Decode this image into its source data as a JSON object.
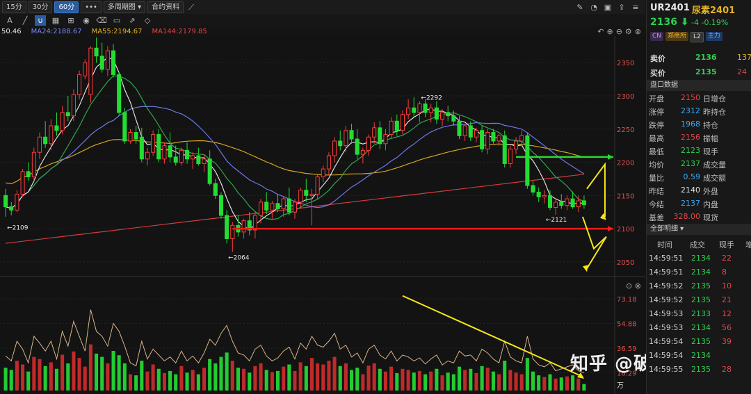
{
  "toolbar": {
    "periods": [
      "15分",
      "30分",
      "60分"
    ],
    "active_period": "60分",
    "multi_period": "多周期图",
    "contract_info": "合约资料",
    "letter_a": "A"
  },
  "ma_legend": [
    {
      "label": "50.46",
      "color": "#e6e6e6"
    },
    {
      "label": "MA24:2188.67",
      "color": "#7b86ff"
    },
    {
      "label": "MA55:2194.67",
      "color": "#e6b422"
    },
    {
      "label": "MA144:2179.85",
      "color": "#e64545"
    }
  ],
  "side": {
    "symbol": "UR2401",
    "name": "尿素2401",
    "price": "2136",
    "change": "-4",
    "change_pct": "-0.19%",
    "badges": [
      "CN",
      "郑商所",
      "L2",
      "主力"
    ],
    "ask_label": "卖价",
    "ask_price": "2136",
    "ask_vol": "137",
    "bid_label": "买价",
    "bid_price": "2135",
    "bid_vol": "24",
    "panel_title": "盘口数据",
    "stats": [
      {
        "k": "开盘",
        "v": "2150",
        "c": "#e64545",
        "k2": "日增仓"
      },
      {
        "k": "涨停",
        "v": "2312",
        "c": "#3fa9f5",
        "k2": "昨持仓"
      },
      {
        "k": "跌停",
        "v": "1968",
        "c": "#3fa9f5",
        "k2": "持仓"
      },
      {
        "k": "最高",
        "v": "2156",
        "c": "#e64545",
        "k2": "振幅"
      },
      {
        "k": "最低",
        "v": "2123",
        "c": "#2fd14f",
        "k2": "现手"
      },
      {
        "k": "均价",
        "v": "2137",
        "c": "#2fd14f",
        "k2": "成交量"
      },
      {
        "k": "量比",
        "v": "0.59",
        "c": "#3fa9f5",
        "k2": "成交额"
      },
      {
        "k": "昨结",
        "v": "2140",
        "c": "#e0e0e0",
        "k2": "外盘"
      },
      {
        "k": "今结",
        "v": "2137",
        "c": "#3fa9f5",
        "k2": "内盘"
      },
      {
        "k": "基差",
        "v": "328.00",
        "c": "#e64545",
        "k2": "现货"
      }
    ],
    "trades_title": "全部明细",
    "trade_cols": [
      "时间",
      "成交",
      "现手",
      "增"
    ],
    "trades": [
      {
        "t": "14:59:51",
        "p": "2134",
        "q": "22"
      },
      {
        "t": "14:59:51",
        "p": "2134",
        "q": "8"
      },
      {
        "t": "14:59:52",
        "p": "2135",
        "q": "10"
      },
      {
        "t": "14:59:52",
        "p": "2135",
        "q": "21"
      },
      {
        "t": "14:59:53",
        "p": "2133",
        "q": "12"
      },
      {
        "t": "14:59:53",
        "p": "2134",
        "q": "56"
      },
      {
        "t": "14:59:54",
        "p": "2135",
        "q": "39"
      },
      {
        "t": "14:59:54",
        "p": "2134",
        "q": ""
      },
      {
        "t": "14:59:55",
        "p": "2135",
        "q": "28"
      }
    ]
  },
  "watermark": "知乎 @破晓投研",
  "chart_data": {
    "type": "candlestick",
    "price_axis": {
      "ticks": [
        2350,
        2300,
        2250,
        2200,
        2150,
        2100,
        2050
      ],
      "range": [
        2030,
        2390
      ]
    },
    "volume_axis": {
      "ticks": [
        "73.18",
        "54.88",
        "36.59",
        "18.29"
      ],
      "unit": "万"
    },
    "annotations": [
      {
        "text": "2109",
        "value": 2109
      },
      {
        "text": "2064",
        "value": 2064
      },
      {
        "text": "2292",
        "value": 2292
      },
      {
        "text": "2121",
        "value": 2121
      }
    ],
    "levels": [
      {
        "name": "resistance",
        "value": 2208,
        "color": "#2bd92b"
      },
      {
        "name": "support",
        "value": 2100,
        "color": "#ff1a1a"
      }
    ],
    "candles": [
      [
        2150,
        2160,
        2118,
        2133
      ],
      [
        2133,
        2140,
        2120,
        2128
      ],
      [
        2128,
        2158,
        2125,
        2152
      ],
      [
        2152,
        2190,
        2148,
        2186
      ],
      [
        2186,
        2200,
        2172,
        2178
      ],
      [
        2178,
        2222,
        2172,
        2215
      ],
      [
        2215,
        2245,
        2205,
        2238
      ],
      [
        2238,
        2262,
        2222,
        2228
      ],
      [
        2228,
        2265,
        2218,
        2255
      ],
      [
        2255,
        2275,
        2240,
        2248
      ],
      [
        2248,
        2285,
        2242,
        2275
      ],
      [
        2275,
        2300,
        2262,
        2270
      ],
      [
        2270,
        2310,
        2262,
        2302
      ],
      [
        2302,
        2338,
        2295,
        2332
      ],
      [
        2330,
        2355,
        2325,
        2350
      ],
      [
        2302,
        2375,
        2290,
        2372
      ],
      [
        2372,
        2388,
        2350,
        2360
      ],
      [
        2360,
        2380,
        2335,
        2340
      ],
      [
        2340,
        2375,
        2330,
        2368
      ],
      [
        2368,
        2378,
        2328,
        2332
      ],
      [
        2332,
        2336,
        2270,
        2275
      ],
      [
        2275,
        2282,
        2228,
        2232
      ],
      [
        2232,
        2250,
        2228,
        2245
      ],
      [
        2245,
        2255,
        2228,
        2235
      ],
      [
        2238,
        2252,
        2200,
        2205
      ],
      [
        2205,
        2222,
        2195,
        2215
      ],
      [
        2215,
        2248,
        2210,
        2242
      ],
      [
        2242,
        2250,
        2200,
        2205
      ],
      [
        2205,
        2230,
        2198,
        2225
      ],
      [
        2225,
        2245,
        2200,
        2208
      ],
      [
        2208,
        2225,
        2195,
        2200
      ],
      [
        2200,
        2222,
        2195,
        2218
      ],
      [
        2218,
        2230,
        2198,
        2205
      ],
      [
        2205,
        2215,
        2190,
        2210
      ],
      [
        2210,
        2222,
        2195,
        2198
      ],
      [
        2198,
        2212,
        2185,
        2205
      ],
      [
        2205,
        2218,
        2165,
        2168
      ],
      [
        2168,
        2175,
        2145,
        2150
      ],
      [
        2150,
        2155,
        2115,
        2120
      ],
      [
        2120,
        2128,
        2078,
        2085
      ],
      [
        2085,
        2110,
        2065,
        2105
      ],
      [
        2105,
        2120,
        2088,
        2095
      ],
      [
        2095,
        2115,
        2085,
        2112
      ],
      [
        2112,
        2125,
        2090,
        2098
      ],
      [
        2098,
        2125,
        2085,
        2120
      ],
      [
        2120,
        2145,
        2108,
        2140
      ],
      [
        2140,
        2155,
        2122,
        2128
      ],
      [
        2128,
        2142,
        2115,
        2138
      ],
      [
        2138,
        2152,
        2125,
        2130
      ],
      [
        2130,
        2148,
        2118,
        2145
      ],
      [
        2145,
        2162,
        2120,
        2125
      ],
      [
        2125,
        2145,
        2115,
        2140
      ],
      [
        2140,
        2162,
        2130,
        2158
      ],
      [
        2158,
        2175,
        2140,
        2150
      ],
      [
        2150,
        2160,
        2105,
        2152
      ],
      [
        2152,
        2182,
        2145,
        2178
      ],
      [
        2178,
        2195,
        2170,
        2190
      ],
      [
        2190,
        2215,
        2180,
        2210
      ],
      [
        2210,
        2238,
        2200,
        2232
      ],
      [
        2232,
        2248,
        2218,
        2225
      ],
      [
        2225,
        2255,
        2215,
        2248
      ],
      [
        2248,
        2258,
        2228,
        2235
      ],
      [
        2235,
        2250,
        2205,
        2212
      ],
      [
        2212,
        2222,
        2198,
        2218
      ],
      [
        2218,
        2242,
        2210,
        2238
      ],
      [
        2238,
        2260,
        2228,
        2252
      ],
      [
        2252,
        2262,
        2220,
        2228
      ],
      [
        2228,
        2250,
        2218,
        2242
      ],
      [
        2242,
        2268,
        2235,
        2262
      ],
      [
        2262,
        2272,
        2240,
        2248
      ],
      [
        2248,
        2278,
        2242,
        2272
      ],
      [
        2272,
        2295,
        2265,
        2282
      ],
      [
        2282,
        2298,
        2268,
        2275
      ],
      [
        2275,
        2292,
        2260,
        2288
      ],
      [
        2288,
        2295,
        2268,
        2275
      ],
      [
        2275,
        2288,
        2260,
        2282
      ],
      [
        2282,
        2292,
        2258,
        2265
      ],
      [
        2265,
        2280,
        2255,
        2275
      ],
      [
        2275,
        2285,
        2262,
        2270
      ],
      [
        2270,
        2278,
        2255,
        2262
      ],
      [
        2262,
        2270,
        2235,
        2240
      ],
      [
        2240,
        2258,
        2232,
        2255
      ],
      [
        2255,
        2262,
        2232,
        2238
      ],
      [
        2238,
        2252,
        2230,
        2248
      ],
      [
        2248,
        2255,
        2215,
        2220
      ],
      [
        2220,
        2250,
        2212,
        2245
      ],
      [
        2245,
        2250,
        2228,
        2232
      ],
      [
        2232,
        2245,
        2225,
        2240
      ],
      [
        2240,
        2248,
        2192,
        2198
      ],
      [
        2198,
        2225,
        2192,
        2220
      ],
      [
        2220,
        2238,
        2212,
        2232
      ],
      [
        2232,
        2248,
        2225,
        2240
      ],
      [
        2240,
        2245,
        2160,
        2165
      ],
      [
        2165,
        2172,
        2150,
        2155
      ],
      [
        2155,
        2162,
        2140,
        2148
      ],
      [
        2148,
        2158,
        2138,
        2150
      ],
      [
        2150,
        2158,
        2128,
        2132
      ],
      [
        2132,
        2145,
        2121,
        2140
      ],
      [
        2140,
        2152,
        2130,
        2135
      ],
      [
        2135,
        2150,
        2128,
        2145
      ],
      [
        2145,
        2156,
        2130,
        2133
      ],
      [
        2133,
        2150,
        2125,
        2142
      ],
      [
        2142,
        2150,
        2130,
        2136
      ]
    ],
    "volumes": [
      0.42,
      0.38,
      0.55,
      0.48,
      0.35,
      0.62,
      0.58,
      0.45,
      0.52,
      0.4,
      0.66,
      0.5,
      0.72,
      0.6,
      0.44,
      0.85,
      0.68,
      0.62,
      0.5,
      0.73,
      0.65,
      0.5,
      0.3,
      0.28,
      0.55,
      0.35,
      0.48,
      0.4,
      0.32,
      0.36,
      0.3,
      0.45,
      0.33,
      0.38,
      0.3,
      0.42,
      0.58,
      0.5,
      0.62,
      0.7,
      0.55,
      0.42,
      0.4,
      0.33,
      0.45,
      0.5,
      0.38,
      0.34,
      0.36,
      0.44,
      0.48,
      0.36,
      0.52,
      0.45,
      0.6,
      0.5,
      0.48,
      0.55,
      0.62,
      0.45,
      0.5,
      0.38,
      0.42,
      0.3,
      0.46,
      0.5,
      0.4,
      0.35,
      0.44,
      0.32,
      0.4,
      0.38,
      0.33,
      0.36,
      0.3,
      0.35,
      0.4,
      0.28,
      0.33,
      0.3,
      0.44,
      0.38,
      0.4,
      0.32,
      0.45,
      0.42,
      0.35,
      0.3,
      0.55,
      0.38,
      0.33,
      0.3,
      0.6,
      0.35,
      0.28,
      0.25,
      0.3,
      0.22,
      0.24,
      0.26,
      0.28,
      0.22,
      0.12
    ],
    "oi_line": [
      0.35,
      0.3,
      0.5,
      0.42,
      0.28,
      0.55,
      0.48,
      0.4,
      0.5,
      0.32,
      0.6,
      0.45,
      0.7,
      0.55,
      0.4,
      0.82,
      0.6,
      0.55,
      0.45,
      0.68,
      0.6,
      0.45,
      0.28,
      0.25,
      0.5,
      0.32,
      0.42,
      0.36,
      0.3,
      0.34,
      0.28,
      0.4,
      0.3,
      0.35,
      0.28,
      0.38,
      0.52,
      0.46,
      0.58,
      0.66,
      0.5,
      0.38,
      0.36,
      0.3,
      0.42,
      0.46,
      0.35,
      0.3,
      0.33,
      0.4,
      0.44,
      0.32,
      0.48,
      0.42,
      0.55,
      0.46,
      0.44,
      0.5,
      0.58,
      0.42,
      0.46,
      0.34,
      0.38,
      0.28,
      0.42,
      0.46,
      0.36,
      0.32,
      0.4,
      0.3,
      0.36,
      0.34,
      0.3,
      0.33,
      0.27,
      0.32,
      0.36,
      0.26,
      0.3,
      0.28,
      0.4,
      0.35,
      0.36,
      0.3,
      0.42,
      0.38,
      0.32,
      0.28,
      0.5,
      0.34,
      0.3,
      0.28,
      0.55,
      0.32,
      0.26,
      0.24,
      0.28,
      0.2,
      0.22,
      0.24,
      0.26,
      0.2,
      0.18
    ]
  }
}
